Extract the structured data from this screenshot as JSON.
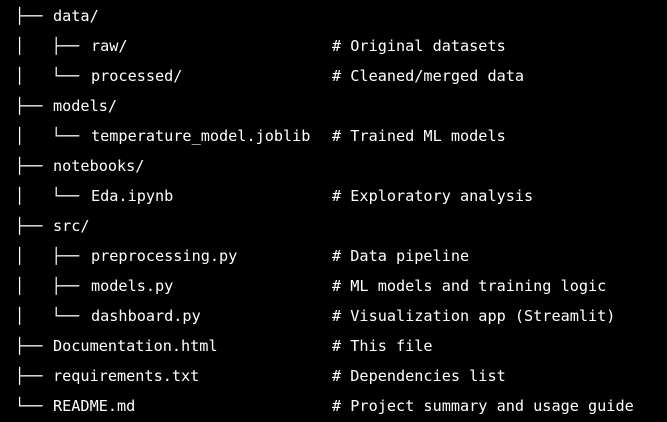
{
  "tree": {
    "rows": [
      {
        "prefix": "├── ",
        "name": "data/",
        "comment": ""
      },
      {
        "prefix": "│   ├── ",
        "name": "raw/",
        "comment": "# Original datasets"
      },
      {
        "prefix": "│   └── ",
        "name": "processed/",
        "comment": "# Cleaned/merged data"
      },
      {
        "prefix": "├── ",
        "name": "models/",
        "comment": ""
      },
      {
        "prefix": "│   └── ",
        "name": "temperature_model.joblib",
        "comment": "# Trained ML models"
      },
      {
        "prefix": "├── ",
        "name": "notebooks/",
        "comment": ""
      },
      {
        "prefix": "│   └── ",
        "name": "Eda.ipynb",
        "comment": "# Exploratory analysis"
      },
      {
        "prefix": "├── ",
        "name": "src/",
        "comment": ""
      },
      {
        "prefix": "│   ├── ",
        "name": "preprocessing.py",
        "comment": "# Data pipeline"
      },
      {
        "prefix": "│   ├── ",
        "name": "models.py",
        "comment": "# ML models and training logic"
      },
      {
        "prefix": "│   └── ",
        "name": "dashboard.py",
        "comment": "# Visualization app (Streamlit)"
      },
      {
        "prefix": "├── ",
        "name": "Documentation.html",
        "comment": "# This file"
      },
      {
        "prefix": "├── ",
        "name": "requirements.txt",
        "comment": "# Dependencies list"
      },
      {
        "prefix": "└── ",
        "name": "README.md",
        "comment": "# Project summary and usage guide"
      }
    ]
  }
}
